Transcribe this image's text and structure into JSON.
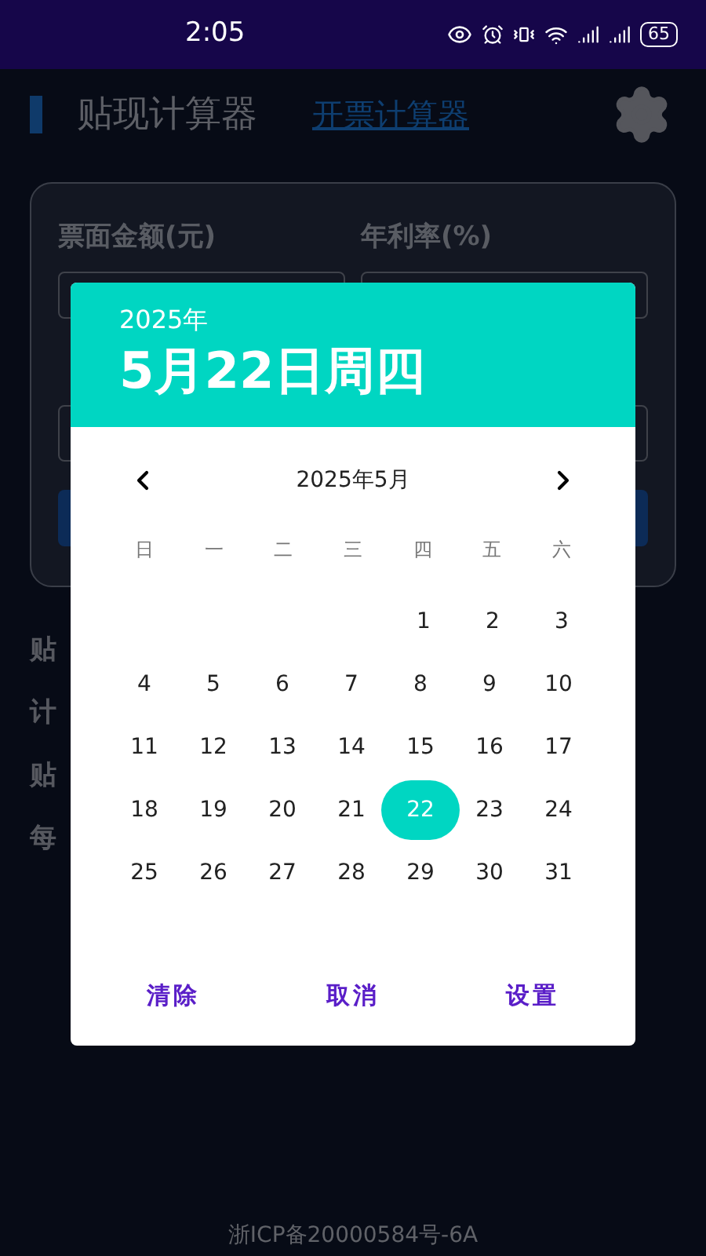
{
  "status_bar": {
    "time": "2:05",
    "battery": "65"
  },
  "header": {
    "title": "贴现计算器",
    "link": "开票计算器"
  },
  "form": {
    "labels": [
      "票面金额(元)",
      "年利率(%)"
    ]
  },
  "results": [
    "贴",
    "计",
    "贴",
    "每"
  ],
  "date_picker": {
    "year": "2025年",
    "date": "5月22日周四",
    "month": "2025年5月",
    "weekdays": [
      "日",
      "一",
      "二",
      "三",
      "四",
      "五",
      "六"
    ],
    "weeks": [
      {
        "days": [
          {
            "day": "1",
            "selected": false
          },
          {
            "day": "2",
            "selected": false
          },
          {
            "day": "3",
            "selected": false
          }
        ]
      },
      {
        "days": [
          {
            "day": "4",
            "selected": false
          },
          {
            "day": "5",
            "selected": false
          },
          {
            "day": "6",
            "selected": false
          },
          {
            "day": "7",
            "selected": false
          },
          {
            "day": "8",
            "selected": false
          },
          {
            "day": "9",
            "selected": false
          },
          {
            "day": "10",
            "selected": false
          }
        ]
      },
      {
        "days": [
          {
            "day": "11",
            "selected": false
          },
          {
            "day": "12",
            "selected": false
          },
          {
            "day": "13",
            "selected": false
          },
          {
            "day": "14",
            "selected": false
          },
          {
            "day": "15",
            "selected": false
          },
          {
            "day": "16",
            "selected": false
          },
          {
            "day": "17",
            "selected": false
          }
        ]
      },
      {
        "days": [
          {
            "day": "18",
            "selected": false
          },
          {
            "day": "19",
            "selected": false
          },
          {
            "day": "20",
            "selected": false
          },
          {
            "day": "21",
            "selected": false
          },
          {
            "day": "22",
            "selected": true
          },
          {
            "day": "23",
            "selected": false
          },
          {
            "day": "24",
            "selected": false
          }
        ]
      },
      {
        "days": [
          {
            "day": "25",
            "selected": false
          },
          {
            "day": "26",
            "selected": false
          },
          {
            "day": "27",
            "selected": false
          },
          {
            "day": "28",
            "selected": false
          },
          {
            "day": "29",
            "selected": false
          },
          {
            "day": "30",
            "selected": false
          },
          {
            "day": "31",
            "selected": false
          }
        ]
      }
    ],
    "actions": [
      "清除",
      "取消",
      "设置"
    ]
  },
  "footer": "浙ICP备20000584号-6A"
}
